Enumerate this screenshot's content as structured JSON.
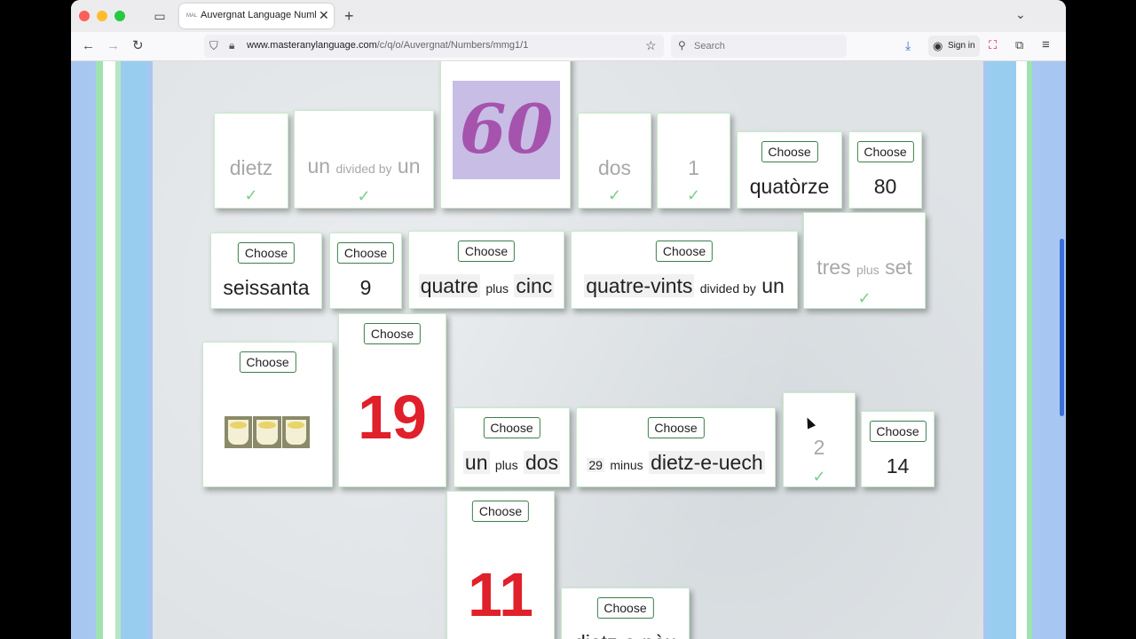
{
  "browser": {
    "tab_title": "Auvergnat Language Numbers M",
    "tab_favicon_text": "MAL",
    "url_domain": "www.masteranylanguage.com",
    "url_path": "/c/q/o/Auvergnat/Numbers/mmg1/1",
    "search_placeholder": "Search",
    "signin_label": "Sign in"
  },
  "icons": {
    "back": "back-arrow-icon",
    "forward": "forward-arrow-icon",
    "reload": "reload-icon",
    "shield": "shield-icon",
    "lock": "lock-icon",
    "star": "star-icon",
    "search": "search-icon",
    "download": "download-icon",
    "account": "account-icon",
    "menu": "hamburger-menu-icon"
  },
  "colors": {
    "accent_red": "#e0202a",
    "check_green": "#7bcf8a",
    "button_border": "#3b7e4a",
    "image_bg": "#c7bde5",
    "image_fg": "#a553ad"
  },
  "choose_label": "Choose",
  "check_mark": "✓",
  "cards": {
    "dietz": "dietz",
    "un_div_un": {
      "a": "un",
      "op": "divided by",
      "b": "un"
    },
    "img60": "60",
    "dos": "dos",
    "one": "1",
    "quatorze": "quatòrze",
    "eighty": "80",
    "seissanta": "seissanta",
    "nine": "9",
    "quatre_plus_cinc": {
      "a": "quatre",
      "op": "plus",
      "b": "cinc"
    },
    "quatrevints_div_un": {
      "a": "quatre-vints",
      "op": "divided by",
      "b": "un"
    },
    "tres_plus_set": {
      "a": "tres",
      "op": "plus",
      "b": "set"
    },
    "nineteen": "19",
    "un_plus_dos": {
      "a": "un",
      "op": "plus",
      "b": "dos"
    },
    "minus_card": {
      "a": "29",
      "op": "minus",
      "b": "dietz-e-uech"
    },
    "two": "2",
    "fourteen": "14",
    "eleven": "11",
    "dietz_e_nou": "dietz-e-nòu"
  }
}
